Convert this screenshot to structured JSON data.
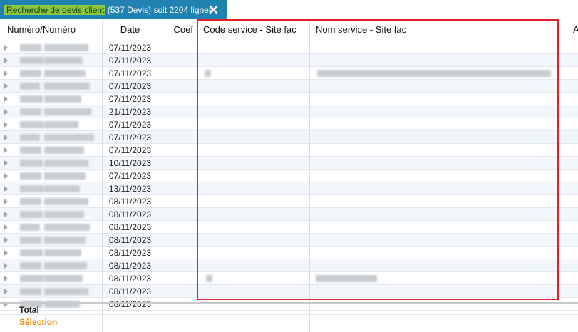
{
  "tab": {
    "highlight": "Recherche de devis client",
    "rest": " (537 Devis) soit 2204 lignes",
    "close_icon": "close-icon"
  },
  "columns": {
    "numero": "Numéro/Numéro",
    "date": "Date",
    "coef": "Coef",
    "code_service": "Code service - Site fac",
    "nom_service": "Nom service - Site fac",
    "extra": "A"
  },
  "rows": [
    {
      "date": "07/11/2023"
    },
    {
      "date": "07/11/2023"
    },
    {
      "date": "07/11/2023"
    },
    {
      "date": "07/11/2023"
    },
    {
      "date": "07/11/2023"
    },
    {
      "date": "21/11/2023"
    },
    {
      "date": "07/11/2023"
    },
    {
      "date": "07/11/2023"
    },
    {
      "date": "07/11/2023"
    },
    {
      "date": "10/11/2023"
    },
    {
      "date": "07/11/2023"
    },
    {
      "date": "13/11/2023"
    },
    {
      "date": "08/11/2023"
    },
    {
      "date": "08/11/2023"
    },
    {
      "date": "08/11/2023"
    },
    {
      "date": "08/11/2023"
    },
    {
      "date": "08/11/2023"
    },
    {
      "date": "08/11/2023"
    },
    {
      "date": "08/11/2023"
    },
    {
      "date": "08/11/2023"
    },
    {
      "date": "08/11/2023"
    }
  ],
  "footer": {
    "total_label": "Total",
    "selection_label": "Sélection"
  },
  "colors": {
    "tab_bg": "#1f82b0",
    "tab_highlight": "#8cc63f",
    "selection": "#f08c00",
    "annotation_box": "#e0202a"
  }
}
